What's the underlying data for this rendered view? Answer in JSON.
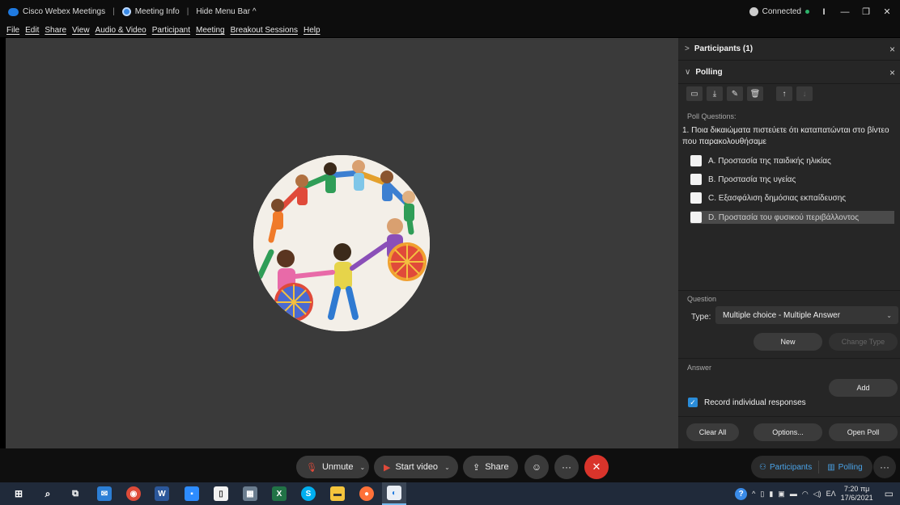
{
  "titlebar": {
    "app_name": "Cisco Webex Meetings",
    "meeting_info": "Meeting Info",
    "hide_menu": "Hide Menu Bar ^",
    "connection": "Connected",
    "minimize": "—",
    "restore": "❐",
    "close": "✕"
  },
  "menubar": {
    "items": [
      "File",
      "Edit",
      "Share",
      "View",
      "Audio & Video",
      "Participant",
      "Meeting",
      "Breakout Sessions",
      "Help"
    ]
  },
  "panel": {
    "participants_header": "Participants (1)",
    "polling_header": "Polling",
    "poll_questions_label": "Poll Questions:",
    "question_text": "1. Ποια δικαιώματα πιστεύετε ότι καταπατώνται στο βίντεο που παρακολουθήσαμε",
    "options": [
      "A. Προστασία της  παιδικής ηλικίας",
      "B. Προστασία της υγείας",
      "C. Εξασφάλιση δημόσιας εκπαίδευσης",
      "D. Προστασία του φυσικού περιβάλλοντος"
    ],
    "question_section": "Question",
    "type_label": "Type:",
    "type_value": "Multiple choice - Multiple Answer",
    "new_button": "New",
    "change_type_button": "Change Type",
    "answer_section": "Answer",
    "add_button": "Add",
    "record_label": "Record individual responses",
    "clear_all_button": "Clear All",
    "options_button": "Options...",
    "open_poll_button": "Open Poll"
  },
  "controls": {
    "unmute": "Unmute",
    "start_video": "Start video",
    "share": "Share",
    "participants_tab": "Participants",
    "polling_tab": "Polling"
  },
  "taskbar": {
    "language": "ΕΛ",
    "time": "7:20 πμ",
    "date": "17/6/2021"
  },
  "colors": {
    "accent": "#4aa3e8",
    "end_call": "#d9342b",
    "checkbox_checked": "#2a8cd8"
  }
}
